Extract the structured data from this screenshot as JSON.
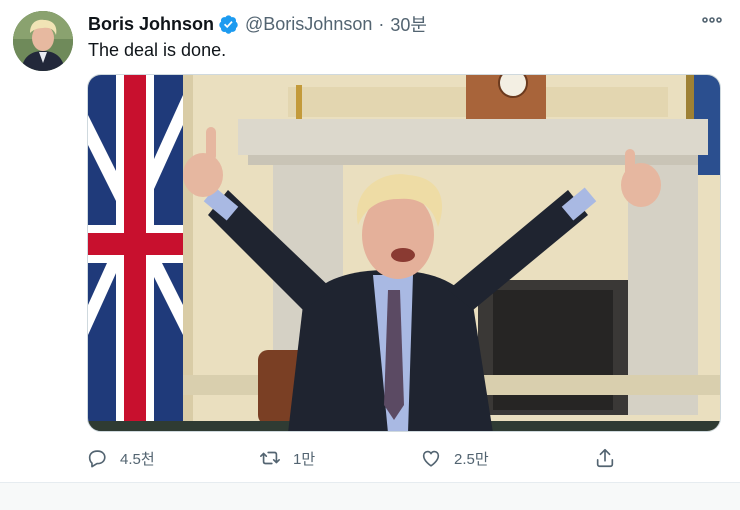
{
  "tweet": {
    "author_name": "Boris Johnson",
    "author_handle": "@BorisJohnson",
    "separator": "·",
    "timestamp": "30분",
    "text": "The deal is done.",
    "verified": true,
    "more_icon": "more-dots-icon"
  },
  "actions": {
    "reply_count": "4.5천",
    "retweet_count": "1만",
    "like_count": "2.5만"
  },
  "icons": {
    "reply": "reply-icon",
    "retweet": "retweet-icon",
    "like": "heart-icon",
    "share": "share-icon",
    "verified": "verified-badge-icon"
  },
  "colors": {
    "verified_blue": "#1d9bf0",
    "text_primary": "#0f1419",
    "text_secondary": "#536471"
  }
}
